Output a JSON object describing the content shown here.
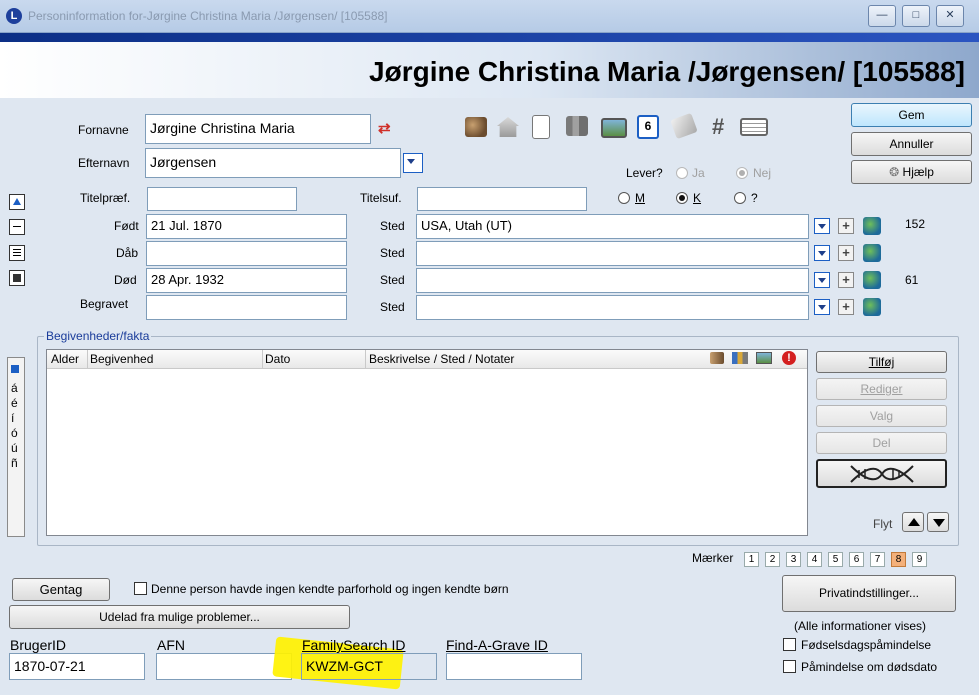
{
  "window": {
    "title": "Personinformation for-Jørgine Christina Maria /Jørgensen/ [105588]",
    "app_icon": "L",
    "minimize": "—",
    "maximize": "□",
    "close": "✕"
  },
  "header": {
    "person_title": "Jørgine Christina Maria /Jørgensen/ [105588]"
  },
  "name": {
    "given_label": "Fornavne",
    "given_value": "Jørgine Christina Maria",
    "surname_label": "Efternavn",
    "surname_value": "Jørgensen",
    "prefix_label": "Titelpræf.",
    "prefix_value": "",
    "suffix_label": "Titelsuf.",
    "suffix_value": ""
  },
  "toolbar_icons": [
    "people-icon",
    "home-icon",
    "document-icon",
    "books-icon",
    "photo-icon",
    "calendar-icon",
    "notes-icon",
    "hash-icon",
    "reference-icon"
  ],
  "calendar_day": "6",
  "hash_glyph": "#",
  "living": {
    "label": "Lever?",
    "yes": "Ja",
    "no": "Nej",
    "selected": "Nej"
  },
  "sex": {
    "m": "M",
    "k": "K",
    "unknown": "?",
    "selected": "K"
  },
  "vitals": {
    "place_label": "Sted",
    "born_label": "Født",
    "born_date": "21 Jul. 1870",
    "born_place": "USA, Utah (UT)",
    "born_count": "152",
    "baptism_label": "Dåb",
    "baptism_date": "",
    "baptism_place": "",
    "death_label": "Død",
    "death_date": "28 Apr. 1932",
    "death_place": "",
    "death_count": "61",
    "burial_label": "Begravet",
    "burial_date": "",
    "burial_place": ""
  },
  "buttons": {
    "save": "Gem",
    "cancel": "Annuller",
    "help": "Hjælp",
    "add": "Tilføj",
    "edit": "Rediger",
    "options": "Valg",
    "delete": "Del",
    "repeat": "Gentag",
    "exclude": "Udelad fra mulige problemer...",
    "privacy": "Privatindstillinger..."
  },
  "side_chars": [
    "á",
    "é",
    "í",
    "ó",
    "ú",
    "ñ"
  ],
  "events": {
    "group_label": "Begivenheder/fakta",
    "columns": [
      "Alder",
      "Begivenhed",
      "Dato",
      "Beskrivelse / Sted / Notater"
    ],
    "rows": [],
    "move_label": "Flyt"
  },
  "markers": {
    "label": "Mærker",
    "items": [
      "1",
      "2",
      "3",
      "4",
      "5",
      "6",
      "7",
      "8",
      "9"
    ],
    "selected": "8"
  },
  "no_family": {
    "label": "Denne person havde ingen kendte parforhold og ingen kendte børn",
    "checked": false
  },
  "privacy_status": "(Alle informationer vises)",
  "reminders": {
    "birthday": "Fødselsdagspåmindelse",
    "deathday": "Påmindelse om dødsdato"
  },
  "ids": {
    "user_label": "BrugerID",
    "user_value": "1870-07-21",
    "afn_label": "AFN",
    "afn_value": "",
    "fs_label": "FamilySearch ID",
    "fs_value": "KWZM-GCT",
    "fag_label": "Find-A-Grave ID",
    "fag_value": ""
  },
  "colors": {
    "highlight": "#fff200",
    "accent": "#1a3c9a",
    "marker_selected": "#f4b07a"
  }
}
